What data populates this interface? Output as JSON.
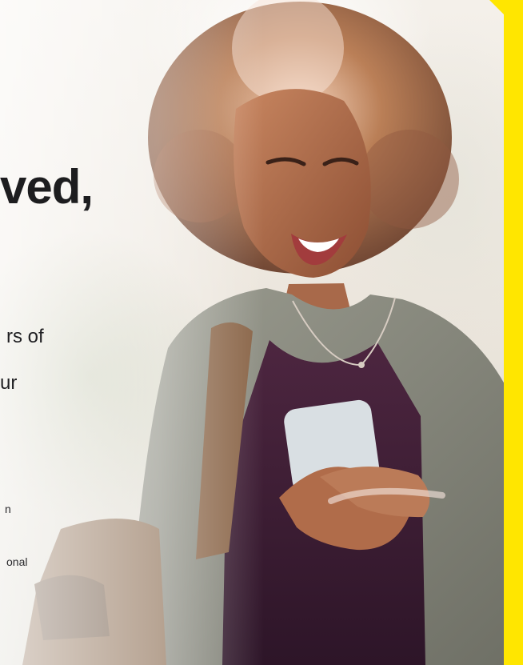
{
  "hero": {
    "headline_fragment": "ved,",
    "body_line_1": "rs of",
    "body_line_2": "ur",
    "fine_line_1": "n",
    "fine_line_2": "onal"
  },
  "colors": {
    "accent": "#ffe600",
    "text": "#1d1d1f"
  }
}
